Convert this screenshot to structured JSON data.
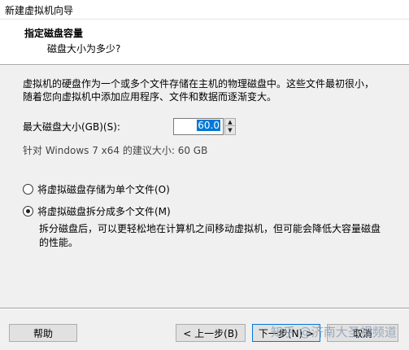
{
  "window": {
    "title": "新建虚拟机向导"
  },
  "header": {
    "title": "指定磁盘容量",
    "subtitle": "磁盘大小为多少?"
  },
  "content": {
    "description": "虚拟机的硬盘作为一个或多个文件存储在主机的物理磁盘中。这些文件最初很小，随着您向虚拟机中添加应用程序、文件和数据而逐渐变大。",
    "max_size_label": "最大磁盘大小(GB)(S):",
    "max_size_value": "60.0",
    "recommendation": "针对 Windows 7 x64 的建议大小: 60 GB",
    "options": [
      {
        "label": "将虚拟磁盘存储为单个文件(O)",
        "selected": false
      },
      {
        "label": "将虚拟磁盘拆分成多个文件(M)",
        "selected": true
      }
    ],
    "split_description": "拆分磁盘后，可以更轻松地在计算机之间移动虚拟机，但可能会降低大容量磁盘的性能。"
  },
  "footer": {
    "help": "帮助",
    "back": "< 上一步(B)",
    "next": "下一步(N) >",
    "cancel": "取消"
  },
  "watermark": "知乎 @济南大圣视频道",
  "colors": {
    "panel_bg": "#f0f0f0",
    "header_bg": "#ffffff",
    "selection": "#0078d7",
    "default_button_border": "#0078d7"
  }
}
